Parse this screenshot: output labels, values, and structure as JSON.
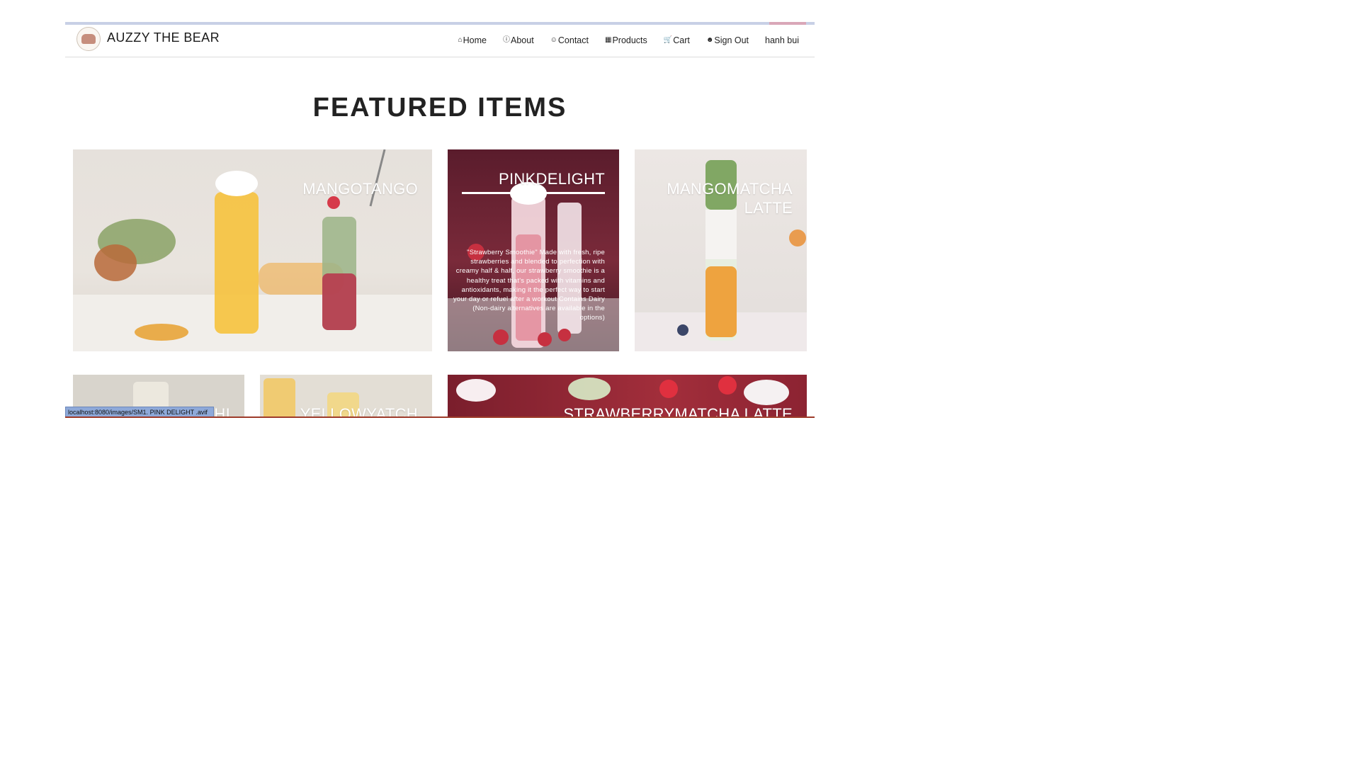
{
  "header": {
    "brand": "AUZZY THE BEAR",
    "nav": [
      {
        "icon": "home-icon",
        "label": "Home"
      },
      {
        "icon": "info-icon",
        "label": "About"
      },
      {
        "icon": "contacts-icon",
        "label": "Contact"
      },
      {
        "icon": "products-icon",
        "label": "Products"
      },
      {
        "icon": "cart-icon",
        "label": "Cart"
      },
      {
        "icon": "users-icon",
        "label": "Sign Out"
      },
      {
        "label": "hanh bui"
      }
    ]
  },
  "main": {
    "title": "FEATURED ITEMS",
    "cards": [
      {
        "label": "MANGOTANGO"
      },
      {
        "label": "PINKDELIGHT",
        "description": "\"Strawberry Smoothie\" Made with fresh, ripe strawberries and blended to perfection with creamy half & half, our strawberry smoothie is a healthy treat that's packed with vitamins and antioxidants, making it the perfect way to start your day or refuel after a workout Contains Dairy (Non-dairy alternatives are available in the options)"
      },
      {
        "label": "MANGOMATCHA LATTE"
      },
      {
        "label": "THI"
      },
      {
        "label": "YELLOWYATCH"
      },
      {
        "label": "STRAWBERRYMATCHA LATTE"
      }
    ]
  },
  "status": {
    "url": "localhost:8080/images/SM1. PINK DELIGHT .avif"
  },
  "colors": {
    "card_dark_red": "#7a2a3a",
    "status_bar": "#8ea9d9"
  }
}
